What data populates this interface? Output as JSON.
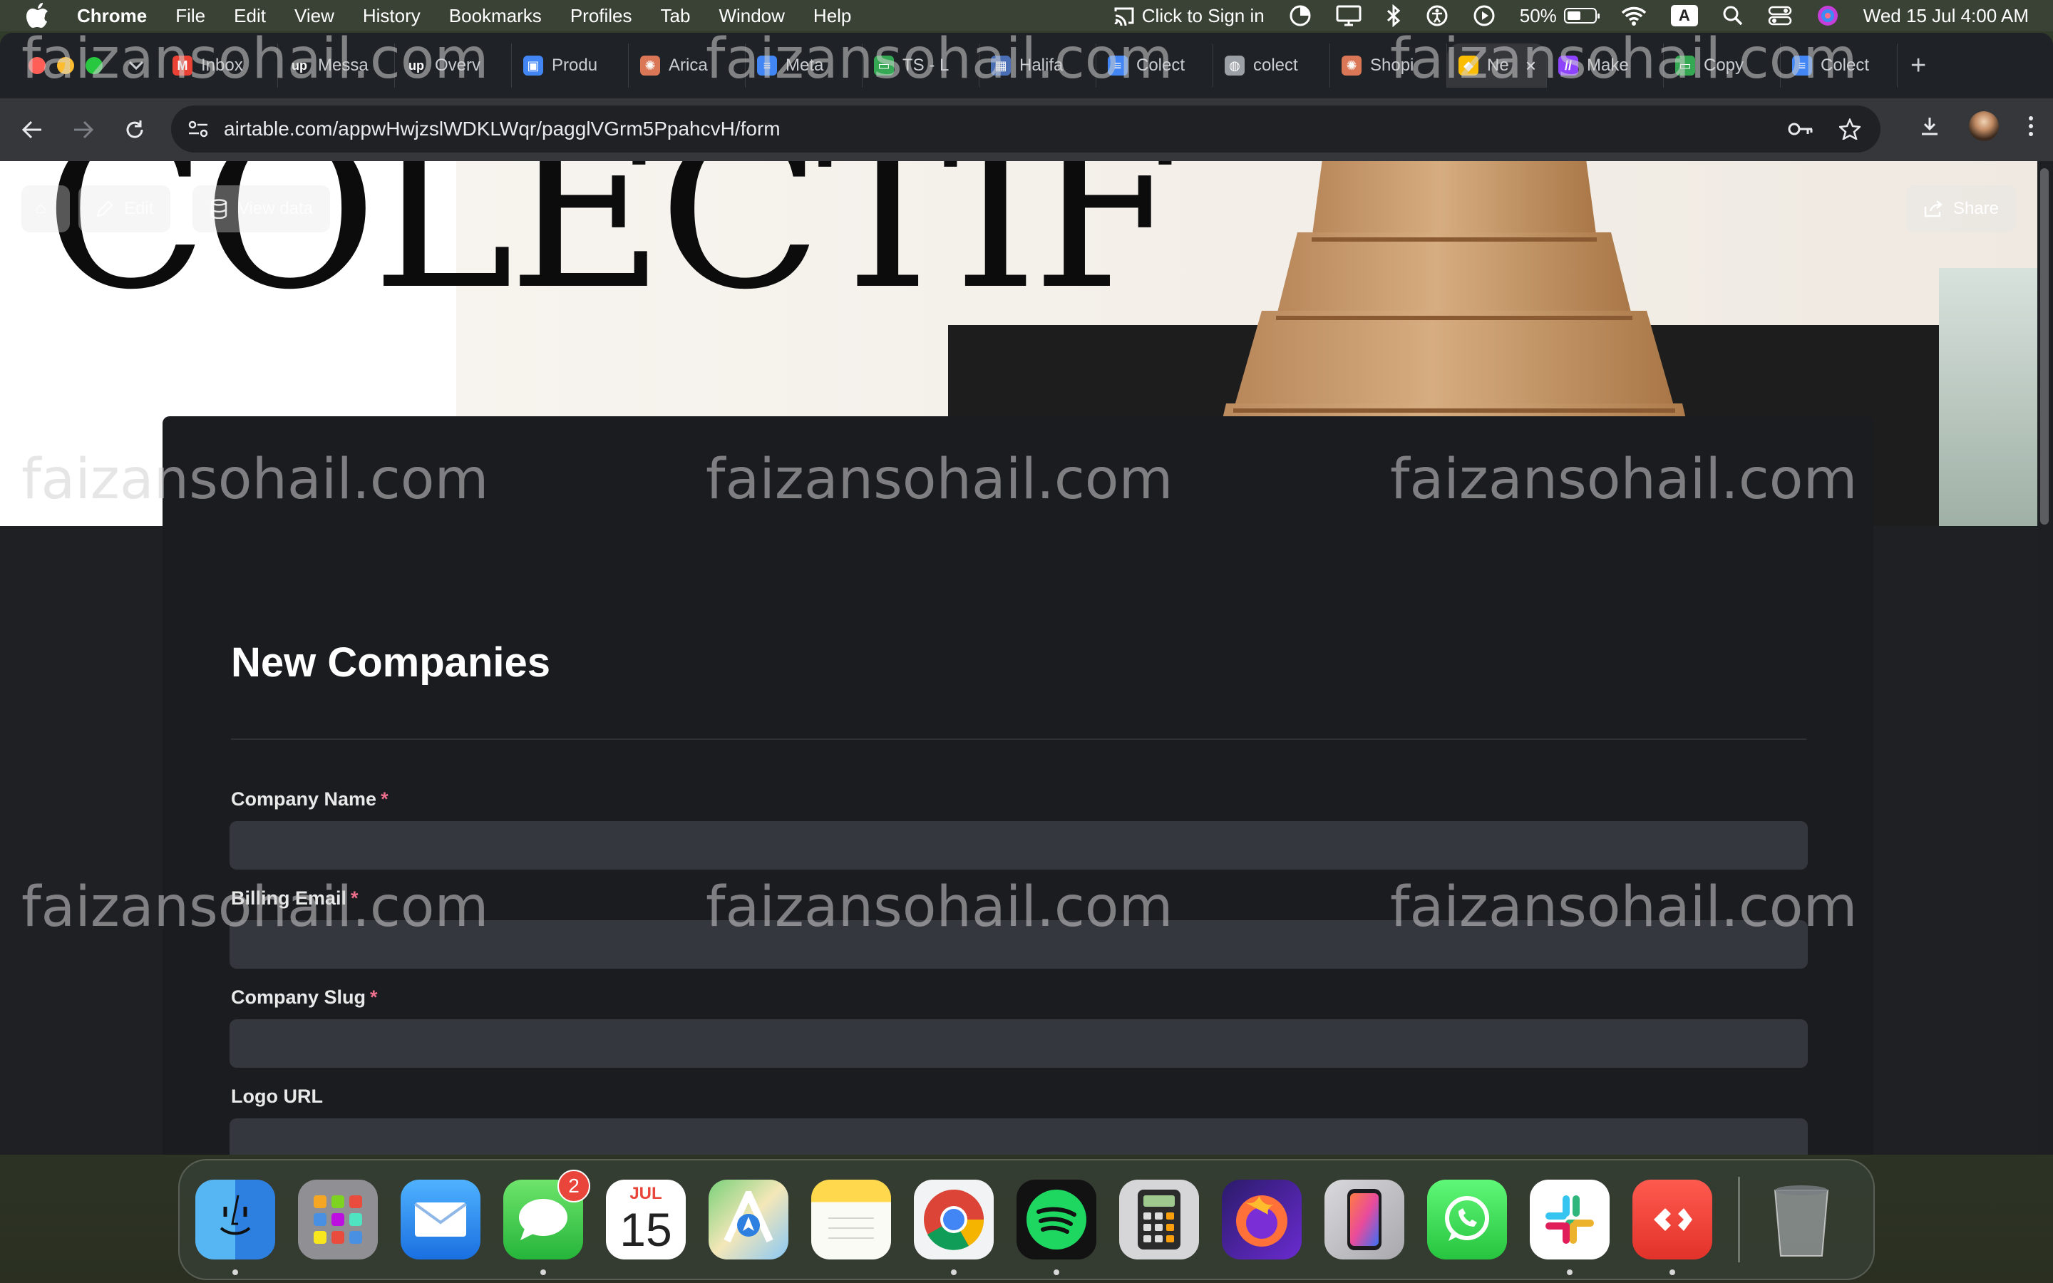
{
  "menubar": {
    "app": "Chrome",
    "items": [
      "File",
      "Edit",
      "View",
      "History",
      "Bookmarks",
      "Profiles",
      "Tab",
      "Window",
      "Help"
    ],
    "sign_in": "Click to Sign in",
    "battery": "50%",
    "battery_level": 0.5,
    "input_source": "A",
    "datetime": "Wed 15 Jul  4:00 AM"
  },
  "browser": {
    "tabs": [
      {
        "label": "Inbox",
        "color": "#ea4335",
        "glyph": "M"
      },
      {
        "label": "Messa",
        "color": "#1f2226",
        "glyph": "up"
      },
      {
        "label": "Overv",
        "color": "#1f2226",
        "glyph": "up"
      },
      {
        "label": "Produ",
        "color": "#4285f4",
        "glyph": "▣"
      },
      {
        "label": "Arica",
        "color": "#d97757",
        "glyph": "✺"
      },
      {
        "label": "Meta",
        "color": "#4285f4",
        "glyph": "≡"
      },
      {
        "label": "TS - L",
        "color": "#34a853",
        "glyph": "▭"
      },
      {
        "label": "Halifa",
        "color": "#4a6fb5",
        "glyph": "▦"
      },
      {
        "label": "Colect",
        "color": "#4285f4",
        "glyph": "≡"
      },
      {
        "label": "colect",
        "color": "#9aa0a6",
        "glyph": "◍"
      },
      {
        "label": "Shopi",
        "color": "#d97757",
        "glyph": "✺"
      },
      {
        "label": "Ne",
        "color": "#fbbc04",
        "glyph": "◆",
        "active": true
      },
      {
        "label": "Make",
        "color": "#8e44ff",
        "glyph": "//"
      },
      {
        "label": "Copy",
        "color": "#34a853",
        "glyph": "▭"
      },
      {
        "label": "Colect",
        "color": "#4285f4",
        "glyph": "≡"
      }
    ],
    "url": "airtable.com/appwHwjzslWDKLWqr/pagglVGrm5PpahcvH/form"
  },
  "cover": {
    "brand": "COLECTIF",
    "home_label": "",
    "edit_label": "Edit",
    "view_data_label": "View data",
    "share_label": "Share"
  },
  "form": {
    "title": "New Companies",
    "fields": [
      {
        "label": "Company Name",
        "required": true,
        "value": ""
      },
      {
        "label": "Billing Email",
        "required": true,
        "value": ""
      },
      {
        "label": "Company Slug",
        "required": true,
        "value": ""
      },
      {
        "label": "Logo URL",
        "required": false,
        "value": ""
      }
    ]
  },
  "watermark": "faizansohail.com",
  "dock": {
    "messages_badge": "2",
    "calendar_month": "JUL",
    "calendar_day": "15"
  }
}
